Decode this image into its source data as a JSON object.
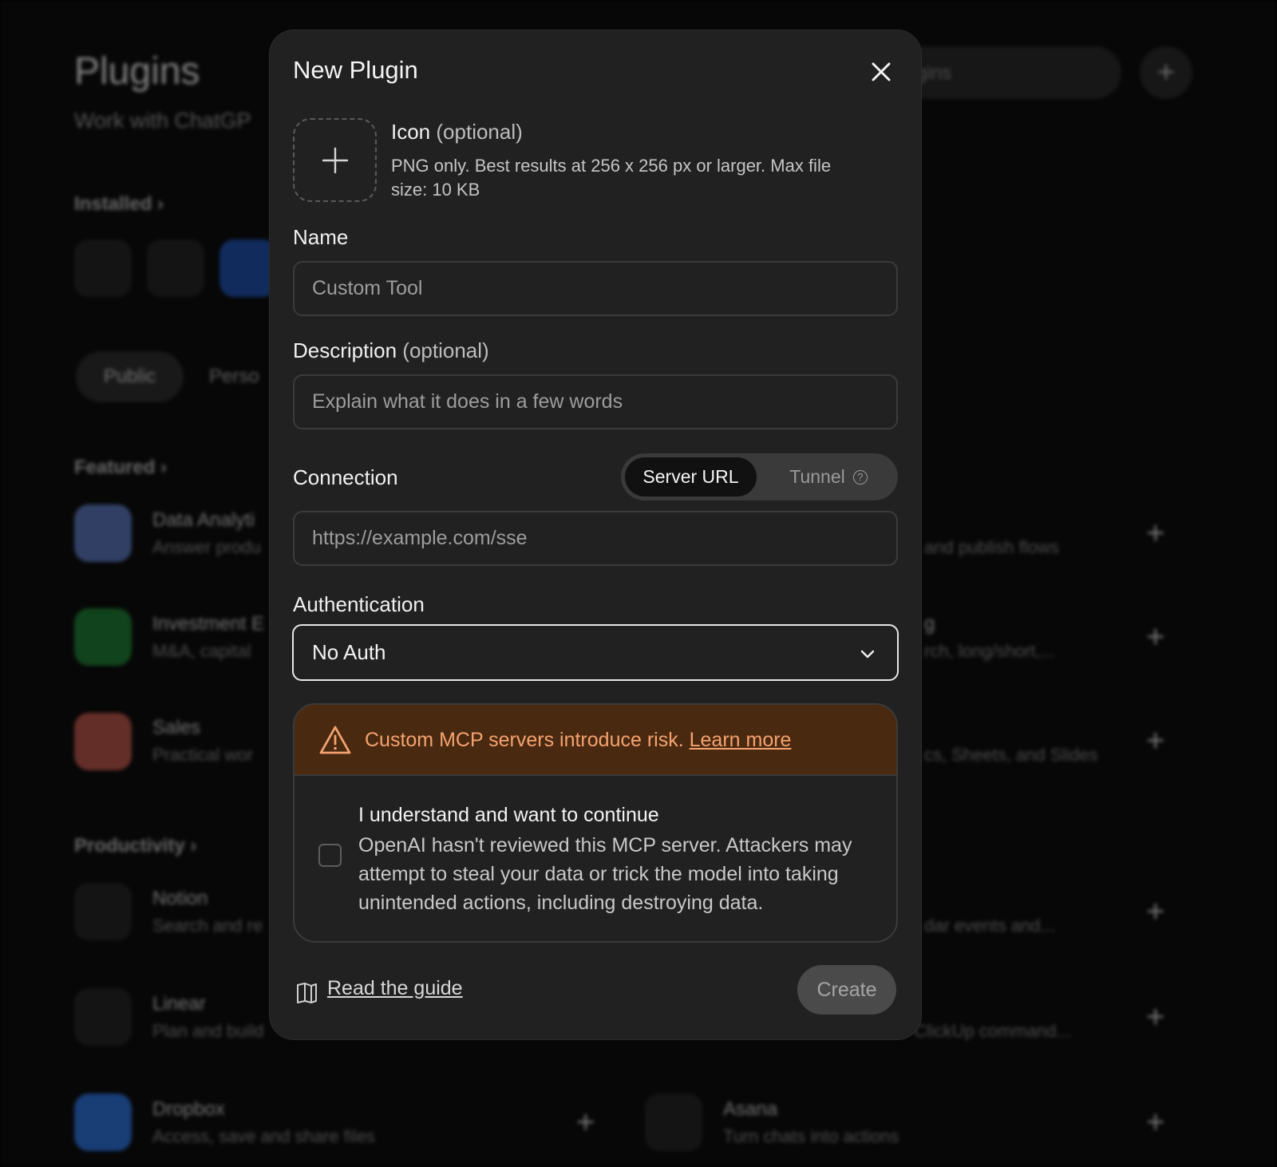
{
  "background": {
    "title": "Plugins",
    "subtitle": "Work with ChatGP",
    "search_fragment": "gins",
    "add_icon": "plus-icon",
    "installed_label": "Installed",
    "tabs": [
      "Public",
      "Perso"
    ],
    "featured_label": "Featured",
    "productivity_label": "Productivity",
    "featured_rows": [
      {
        "title": "Data Analyti",
        "sub": "Answer produ",
        "right_sub": "and publish flows"
      },
      {
        "title": "Investment E",
        "sub": "M&A, capital",
        "right_title": "g",
        "right_sub": "rch, long/short,..."
      },
      {
        "title": "Sales",
        "sub": "Practical wor",
        "right_sub": "cs, Sheets, and Slides"
      }
    ],
    "productivity_rows": [
      {
        "title": "Notion",
        "sub": "Search and re",
        "right_sub": "dar events and..."
      },
      {
        "title": "Linear",
        "sub": "Plan and build",
        "right_sub": "ClickUp command..."
      },
      {
        "title": "Dropbox",
        "sub": "Access, save and share files",
        "right_title": "Asana",
        "right_sub": "Turn chats into actions"
      }
    ]
  },
  "modal": {
    "title": "New Plugin",
    "icon_label": "Icon",
    "optional": "(optional)",
    "icon_help": "PNG only. Best results at 256 x 256 px or larger. Max file size: 10 KB",
    "name_label": "Name",
    "name_placeholder": "Custom Tool",
    "description_label": "Description",
    "description_placeholder": "Explain what it does in a few words",
    "connection_label": "Connection",
    "connection_options": {
      "selected": "Server URL",
      "other": "Tunnel"
    },
    "url_placeholder": "https://example.com/sse",
    "auth_label": "Authentication",
    "auth_value": "No Auth",
    "warning_text": "Custom MCP servers introduce risk.",
    "warning_link": "Learn more",
    "checkbox_title": "I understand and want to continue",
    "checkbox_body": "OpenAI hasn't reviewed this MCP server. Attackers may attempt to steal your data or trick the model into taking unintended actions, including destroying data.",
    "checkbox_checked": false,
    "guide_link": "Read the guide",
    "create_label": "Create"
  },
  "colors": {
    "modal_bg": "#212121",
    "warning_bg": "#4a2911",
    "warning_text": "#f4a36f",
    "create_disabled_bg": "#4a4a4a"
  }
}
